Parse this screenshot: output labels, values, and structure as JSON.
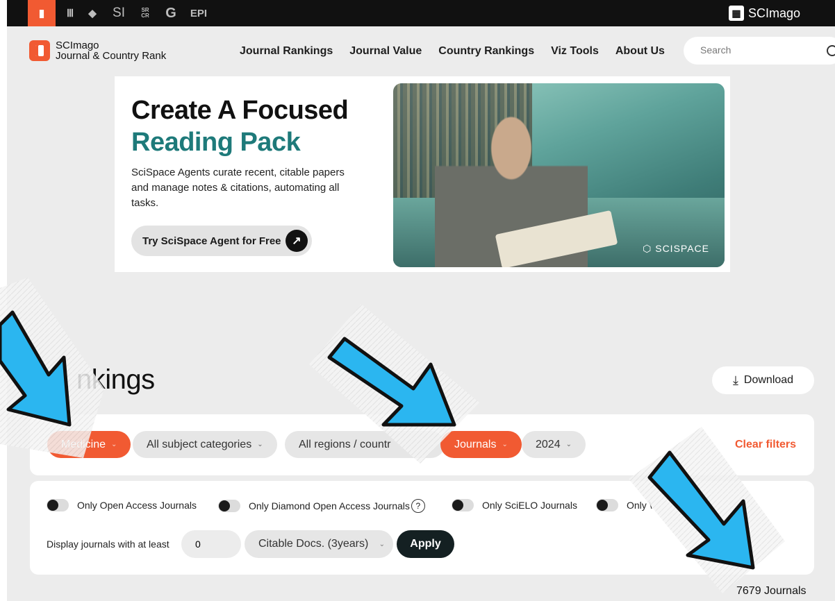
{
  "topbar": {
    "apps": [
      {
        "label": "▮",
        "name": "sjr-app-icon"
      },
      {
        "label": "🏛",
        "name": "institutions-app-icon"
      },
      {
        "label": "⛉",
        "name": "shield-app-icon"
      },
      {
        "label": "SI",
        "name": "si-app-icon"
      },
      {
        "label": "SR CR",
        "name": "srcr-app-icon"
      },
      {
        "label": "G",
        "name": "g-app-icon"
      },
      {
        "label": "EPI",
        "name": "epi-app-icon"
      }
    ],
    "brand": "SCImago"
  },
  "header": {
    "logo_line1": "SCImago",
    "logo_line2": "Journal & Country Rank",
    "nav": [
      "Journal Rankings",
      "Journal Value",
      "Country Rankings",
      "Viz Tools",
      "About Us"
    ],
    "search_placeholder": "Search"
  },
  "ad": {
    "headline_1": "Create A Focused",
    "headline_2": "Reading Pack",
    "body": "SciSpace Agents curate recent, citable papers and manage notes & citations, automating all tasks.",
    "cta": "Try SciSpace Agent for Free",
    "image_brand": "SCISPACE"
  },
  "page": {
    "title": "nkings",
    "download": "Download",
    "filters": {
      "area": "Medicine",
      "category": "All subject categories",
      "region": "All regions / countr",
      "type": "Journals",
      "year": "2024",
      "clear": "Clear filters"
    },
    "options": {
      "toggles": [
        "Only Open Access Journals",
        "Only Diamond Open Access Journals",
        "Only SciELO Journals",
        "Only \\"
      ],
      "help_glyph": "?",
      "min_label": "Display journals with at least",
      "min_value": "0",
      "metric": "Citable Docs. (3years)",
      "apply": "Apply"
    },
    "count": "7679  Journals"
  },
  "colors": {
    "accent": "#f15a32",
    "ad_teal": "#1e7a7a",
    "arrow_blue": "#2bb6f0",
    "apply_bg": "#142022"
  }
}
